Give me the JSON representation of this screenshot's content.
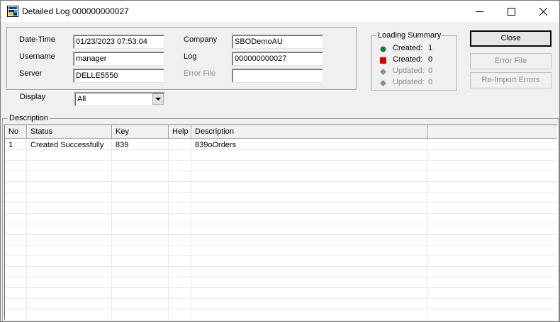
{
  "window": {
    "title": "Detailed Log 000000000027"
  },
  "fields": {
    "datetime": {
      "label": "Date-Time",
      "value": "01/23/2023 07:53:04"
    },
    "username": {
      "label": "Username",
      "value": "manager"
    },
    "server": {
      "label": "Server",
      "value": "DELLE5550"
    },
    "company": {
      "label": "Company",
      "value": "SBODemoAU"
    },
    "log": {
      "label": "Log",
      "value": "000000000027"
    },
    "error_file": {
      "label": "Error File",
      "value": ""
    }
  },
  "display": {
    "label": "Display",
    "selected": "All"
  },
  "summary": {
    "title": "Loading Summary",
    "rows": [
      {
        "label": "Created:",
        "count": "1",
        "color": "#1e7a1e",
        "shape": "circle",
        "enabled": true
      },
      {
        "label": "Created:",
        "count": "0",
        "color": "#e00000",
        "shape": "square",
        "enabled": true
      },
      {
        "label": "Updated:",
        "count": "0",
        "color": "#8d8d8d",
        "shape": "diamond",
        "enabled": false
      },
      {
        "label": "Updated:",
        "count": "0",
        "color": "#8d8d8d",
        "shape": "diamond",
        "enabled": false
      }
    ]
  },
  "buttons": {
    "close": "Close",
    "error_file": "Error File",
    "reimport": "Re-Import Errors"
  },
  "description_group": {
    "label": "Description"
  },
  "table": {
    "columns": [
      "No",
      "Status",
      "Key",
      "Help",
      "Description"
    ],
    "rows": [
      {
        "no": "1",
        "status": "Created Successfully",
        "key": "839",
        "help": "",
        "description": "839oOrders"
      }
    ]
  }
}
